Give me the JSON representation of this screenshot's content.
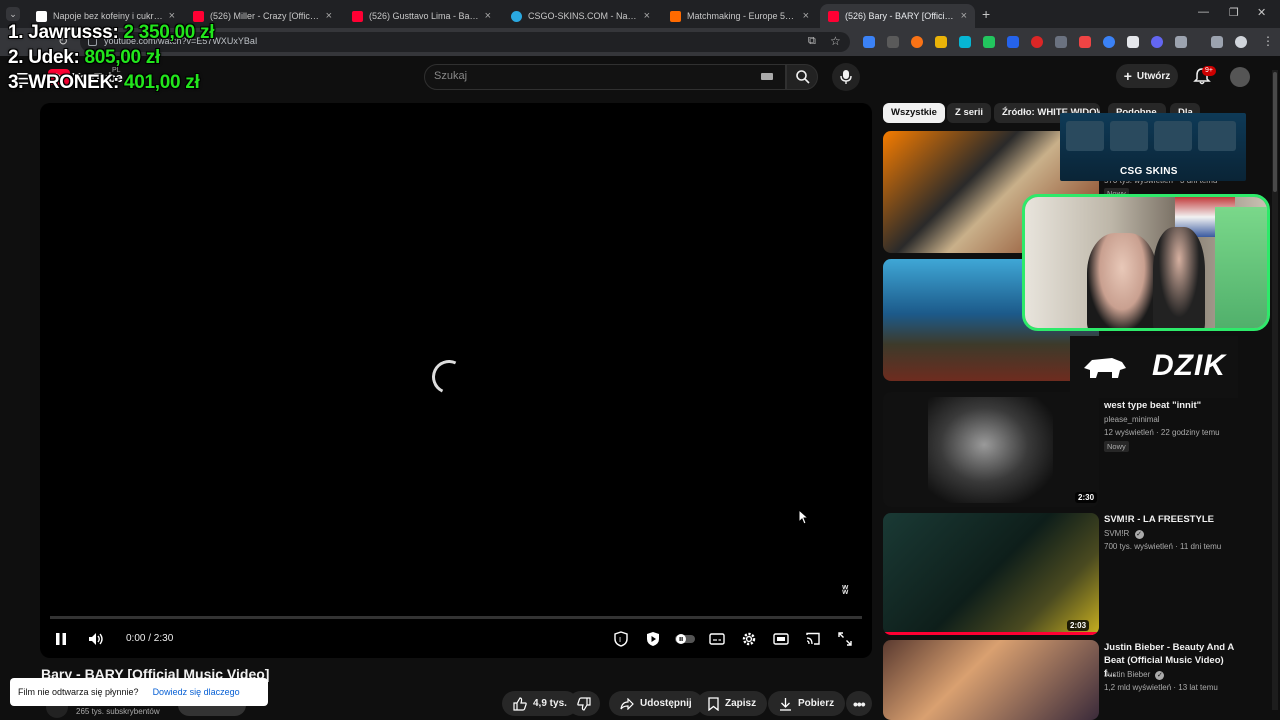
{
  "browser": {
    "tabs": [
      {
        "title": "Napoje bez kofeiny i cukru | Wi",
        "color": "#ffffff",
        "active": false
      },
      {
        "title": "(526) Miller - Crazy [Official Mu",
        "color": "#ff0033",
        "active": false
      },
      {
        "title": "(526) Gusttavo Lima - Balada (L",
        "color": "#ff0033",
        "active": false
      },
      {
        "title": "CSGO-SKINS.COM - Najlepsze",
        "color": "#2aa8e0",
        "active": false
      },
      {
        "title": "Matchmaking - Europe 5v5 Qu",
        "color": "#ff6a00",
        "active": false
      },
      {
        "title": "(526) Bary - BARY [Official Mus",
        "color": "#ff0033",
        "active": true
      }
    ],
    "url": "youtube.com/watch?v=E57WXUxYBaI"
  },
  "overlay": {
    "ranking": [
      {
        "label": "1. Jawrusss: ",
        "amount": "2 350,00 zł"
      },
      {
        "label": "2. Udek: ",
        "amount": "805,00 zł"
      },
      {
        "label": "3. WRONEK: ",
        "amount": "401,00 zł"
      }
    ],
    "banner_text": "CSG SKINS",
    "dzik_text": "DZIK"
  },
  "header": {
    "logo": "YouTube",
    "region": "PL",
    "search_placeholder": "Szukaj",
    "create_label": "Utwórz",
    "notif_count": "9+"
  },
  "player": {
    "time": "0:00 / 2:30",
    "progress": 0
  },
  "video": {
    "title": "Bary - BARY [Official Music Video]",
    "subscribers": "265 tys. subskrybentów",
    "likes": "4,9 tys.",
    "share_label": "Udostępnij",
    "save_label": "Zapisz",
    "download_label": "Pobierz"
  },
  "toast": {
    "message": "Film nie odtwarza się płynnie?",
    "link": "Dowiedz się dlaczego"
  },
  "sidebar": {
    "chips": [
      "Wszystkie",
      "Z serii",
      "Źródło: WHITE WIDOW",
      "Podobne",
      "Dla"
    ],
    "partial_meta": "570 tys. wyświetleń · 3 dni temu",
    "partial_badge": "Nowy",
    "items": [
      {
        "title": "west type beat \"innit\"",
        "channel": "please_minimal",
        "meta": "12 wyświetleń · 22 godziny temu",
        "badge": "Nowy",
        "duration": "2:30"
      },
      {
        "title": "SVM!R - LA FREESTYLE",
        "channel": "SVM!R",
        "meta": "700 tys. wyświetleń · 11 dni temu",
        "duration": "2:03"
      },
      {
        "title": "Justin Bieber - Beauty And A Beat (Official Music Video) f...",
        "channel": "Justin Bieber",
        "meta": "1,2 mld wyświetleń · 13 lat temu"
      }
    ]
  }
}
